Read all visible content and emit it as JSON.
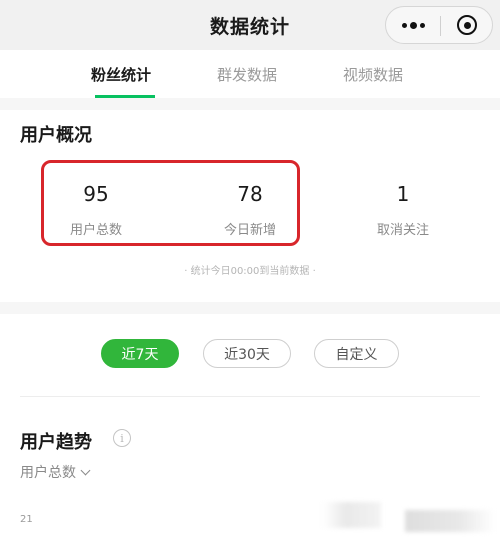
{
  "header": {
    "title": "数据统计",
    "more_icon": "more-dots-icon",
    "close_icon": "close-circle-icon"
  },
  "tabs": [
    {
      "label": "粉丝统计",
      "active": true
    },
    {
      "label": "群发数据",
      "active": false
    },
    {
      "label": "视频数据",
      "active": false
    }
  ],
  "overview": {
    "title": "用户概况",
    "stats": [
      {
        "value": "95",
        "label": "用户总数"
      },
      {
        "value": "78",
        "label": "今日新增"
      },
      {
        "value": "1",
        "label": "取消关注"
      }
    ],
    "note": "· 统计今日00:00到当前数据 ·"
  },
  "ranges": [
    {
      "label": "近7天",
      "active": true
    },
    {
      "label": "近30天",
      "active": false
    },
    {
      "label": "自定义",
      "active": false
    }
  ],
  "trend": {
    "title": "用户趋势",
    "info_icon": "info-icon",
    "metric": "用户总数",
    "axis_top": "21"
  },
  "colors": {
    "accent": "#07c160",
    "highlight": "#d8262b"
  }
}
